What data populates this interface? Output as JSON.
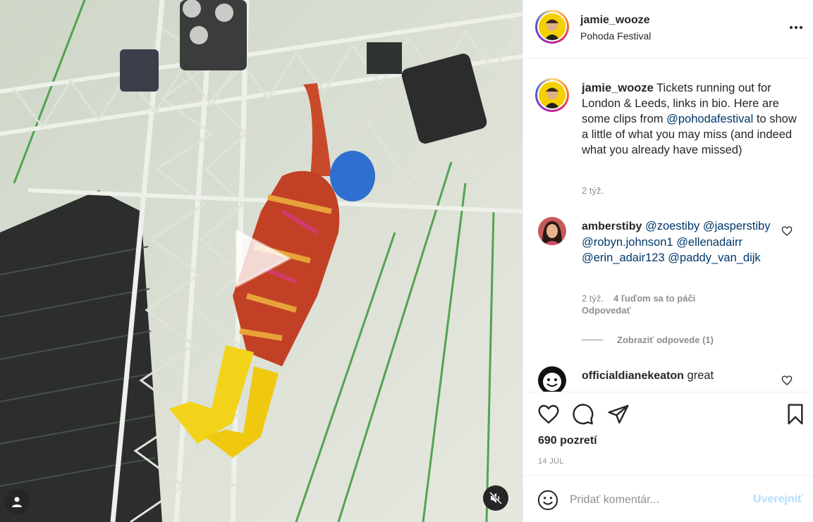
{
  "post": {
    "username": "jamie_wooze",
    "location": "Pohoda Festival",
    "caption": {
      "username": "jamie_wooze",
      "text_before": " Tickets running out for London & Leeds, links in bio. Here are some clips from ",
      "mention": "@pohodafestival",
      "text_after": " to show a little of what you may miss (and indeed what you already have missed)",
      "time": "2 týž."
    },
    "comments": [
      {
        "username": "amberstiby",
        "mentions": [
          "@zoestiby",
          "@jasperstiby",
          "@robyn.johnson1",
          "@ellenadairr",
          "@erin_adair123",
          "@paddy_van_dijk"
        ],
        "time": "2 týž.",
        "likes": "4 ľuďom sa to páči",
        "reply": "Odpovedať",
        "view_replies": "Zobraziť odpovede (1)"
      },
      {
        "username": "officialdianekeaton",
        "text": "great"
      }
    ],
    "views": "690 pozretí",
    "date": "14 JÚL"
  },
  "composer": {
    "placeholder": "Pridať komentár...",
    "post_label": "Uverejniť"
  },
  "icons": {
    "like": "heart-icon",
    "comment": "comment-icon",
    "share": "paper-plane-icon",
    "save": "bookmark-icon",
    "emoji": "emoji-icon",
    "mute": "muted-speaker-icon",
    "user_tag": "user-icon",
    "play": "play-icon",
    "more": "more-options-icon"
  },
  "colors": {
    "mention": "#00376b",
    "muted": "#8e8e8e",
    "post_button_disabled": "#b2dffc",
    "text": "#262626"
  }
}
